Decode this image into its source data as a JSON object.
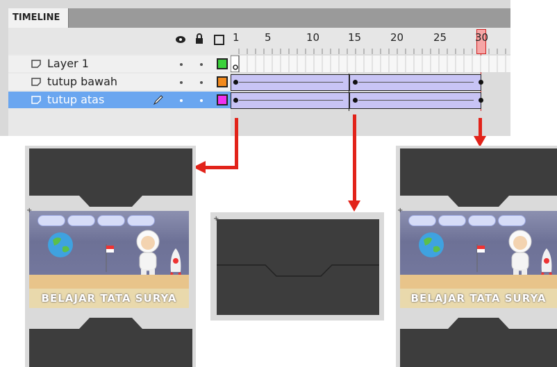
{
  "timeline": {
    "tab_label": "TIMELINE",
    "header_icons": [
      "eye-icon",
      "lock-icon",
      "outline-icon"
    ],
    "ruler": [
      "1",
      "5",
      "10",
      "15",
      "20",
      "25",
      "30"
    ],
    "current_frame": "30",
    "layers": [
      {
        "name": "Layer 1",
        "color": "#3ad13a",
        "selected": false
      },
      {
        "name": "tutup bawah",
        "color": "#f28a1d",
        "selected": false
      },
      {
        "name": "tutup atas",
        "color": "#f030f0",
        "selected": true
      }
    ]
  },
  "screens": {
    "menu_buttons": [
      "",
      "",
      "",
      ""
    ],
    "banner_title": "BELAJAR TATA SURYA"
  },
  "colors": {
    "accent_red": "#e2231a",
    "selected_row": "#6aa6f0",
    "tween_fill": "#c8c4f5"
  }
}
